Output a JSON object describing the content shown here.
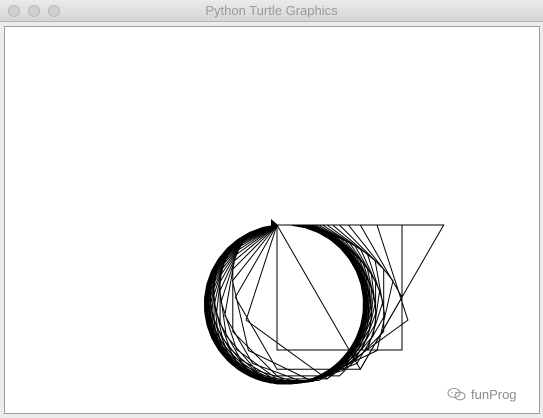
{
  "window": {
    "title": "Python Turtle Graphics"
  },
  "watermark": {
    "text": "funProg",
    "icon": "wechat-icon"
  },
  "colors": {
    "stroke": "#000000",
    "canvas_bg": "#ffffff"
  }
}
